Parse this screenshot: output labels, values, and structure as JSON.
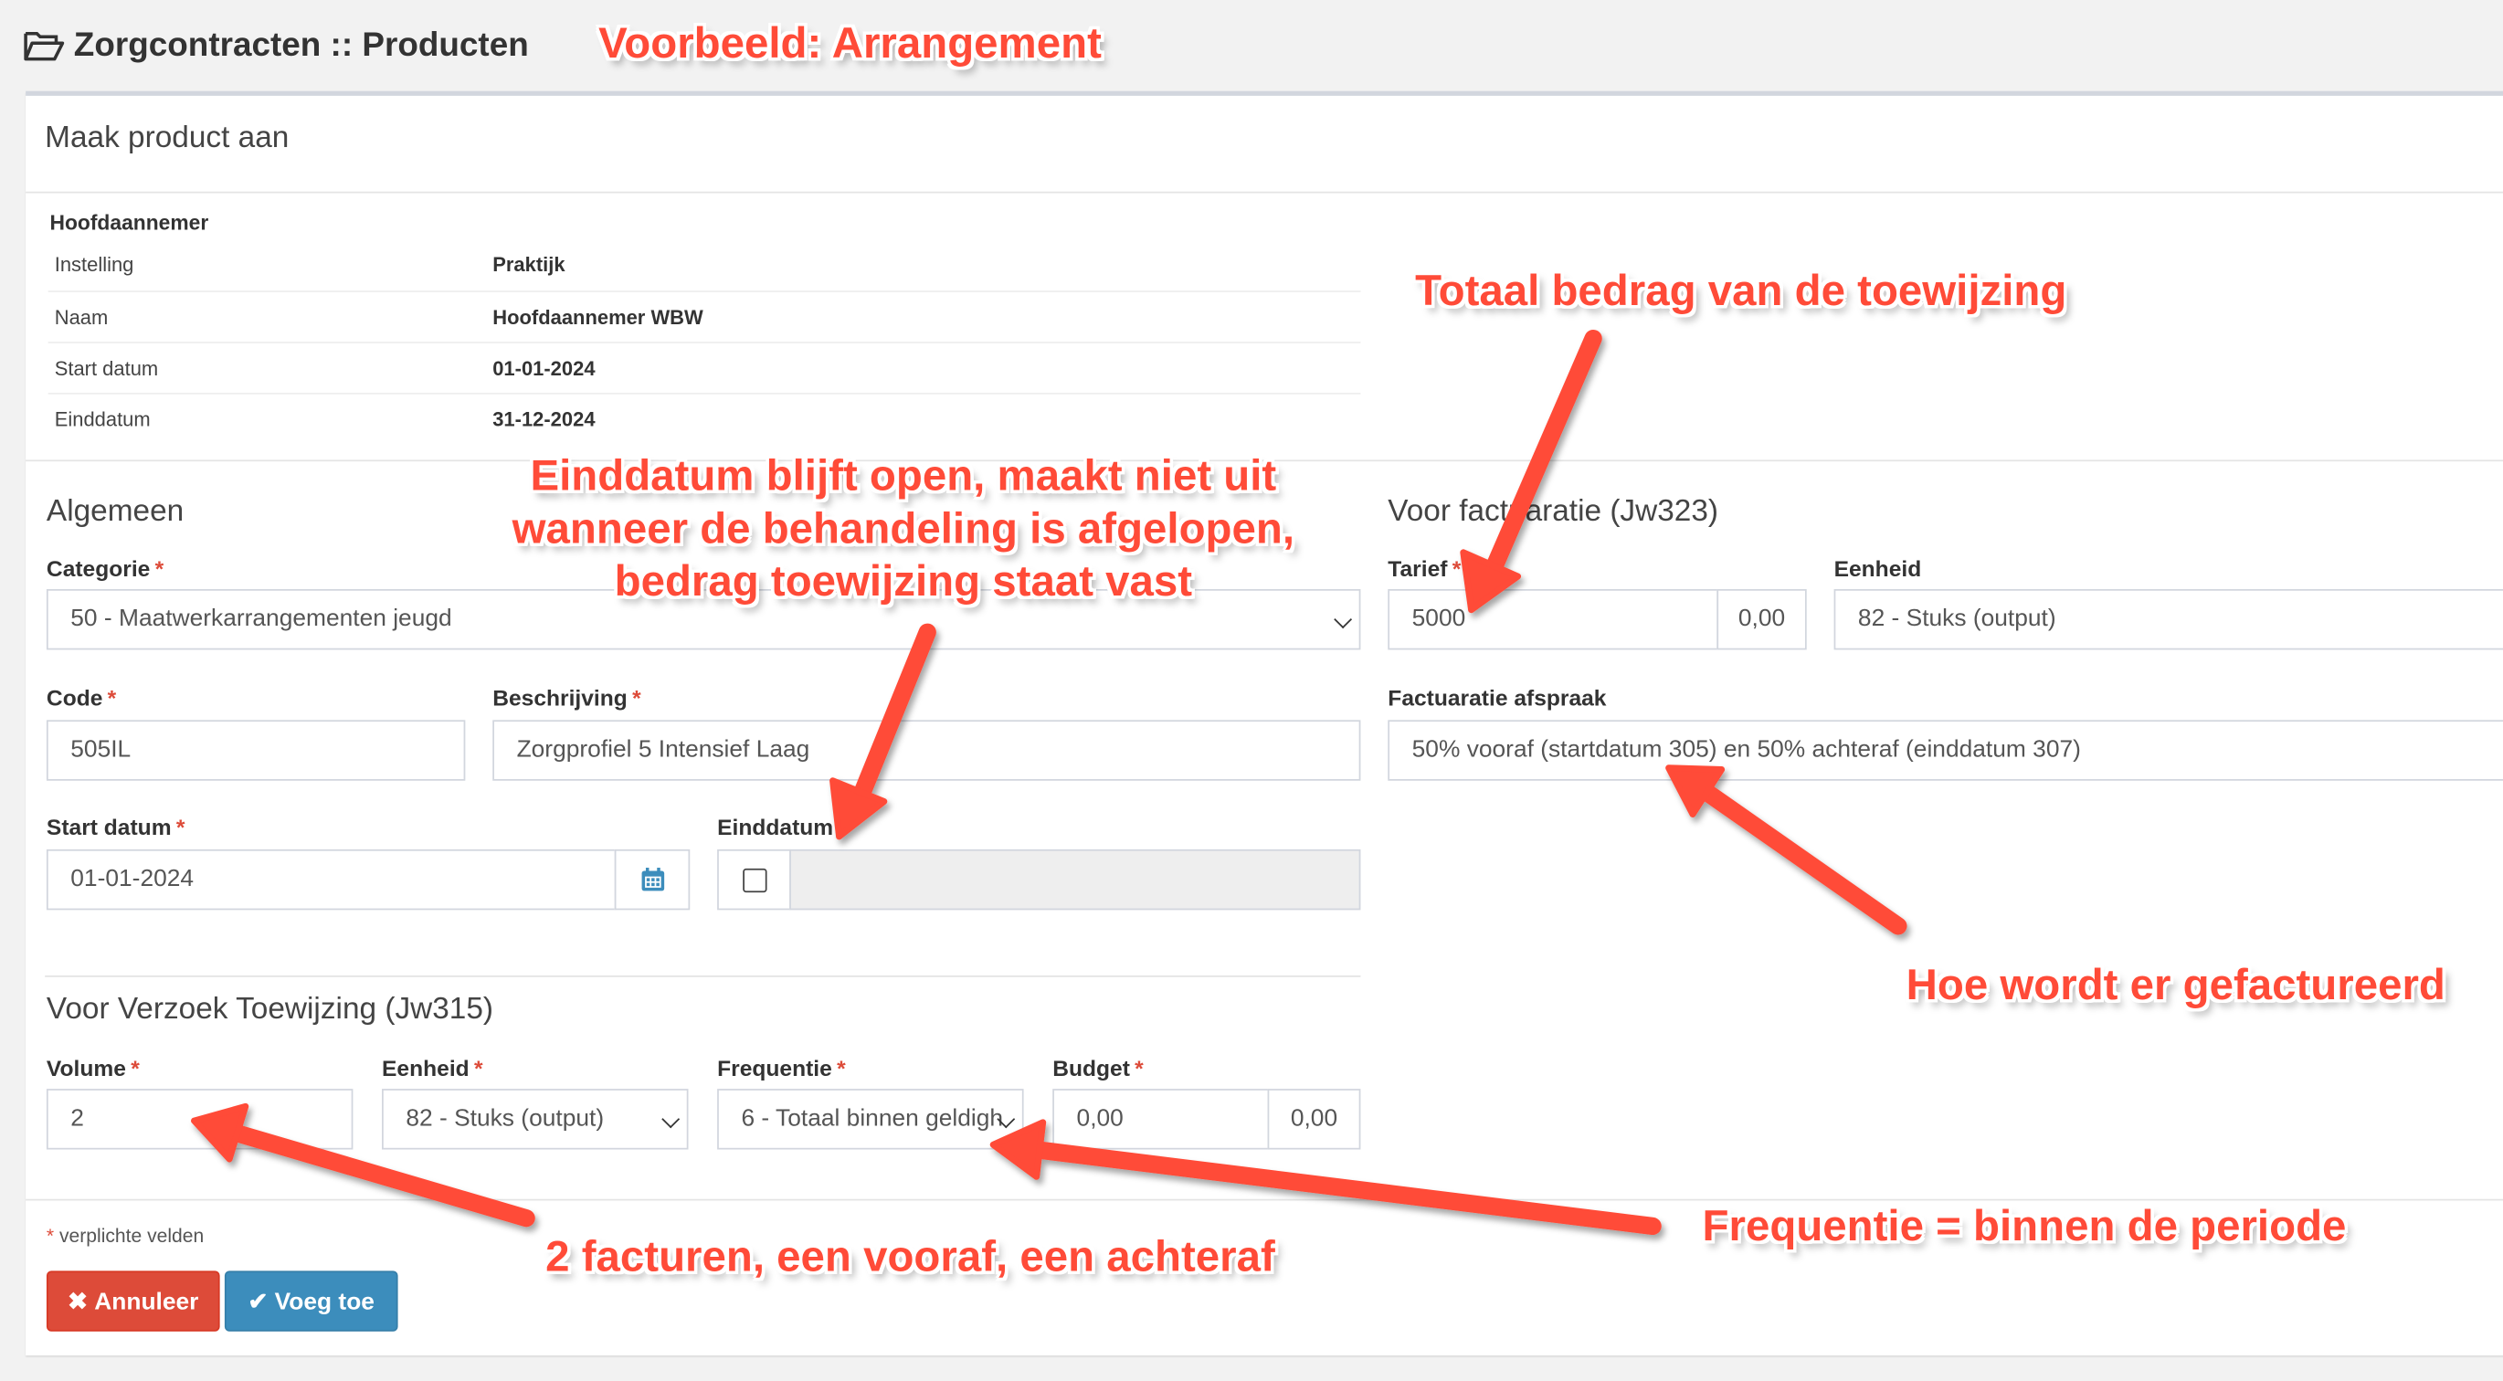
{
  "page": {
    "title": "Zorgcontracten :: Producten",
    "icon": "folder-open-icon"
  },
  "box": {
    "title": "Maak product aan"
  },
  "contractor": {
    "heading": "Hoofdaannemer",
    "rows": [
      {
        "label": "Instelling",
        "value": "Praktijk"
      },
      {
        "label": "Naam",
        "value": "Hoofdaannemer WBW"
      },
      {
        "label": "Start datum",
        "value": "01-01-2024"
      },
      {
        "label": "Einddatum",
        "value": "31-12-2024"
      }
    ]
  },
  "general": {
    "title": "Algemeen",
    "category": {
      "label": "Categorie",
      "value": "50 - Maatwerkarrangementen jeugd"
    },
    "code": {
      "label": "Code",
      "value": "505IL"
    },
    "description": {
      "label": "Beschrijving",
      "value": "Zorgprofiel 5 Intensief Laag"
    },
    "start_date": {
      "label": "Start datum",
      "value": "01-01-2024",
      "icon": "calendar-icon"
    },
    "end_date": {
      "label": "Einddatum",
      "value": "",
      "checked": false
    }
  },
  "billing": {
    "title": "Voor factuaratie (Jw323)",
    "rate": {
      "label": "Tarief",
      "value": "5000",
      "addon": "0,00"
    },
    "unit": {
      "label": "Eenheid",
      "value": "82 - Stuks (output)"
    },
    "agreement": {
      "label": "Factuaratie afspraak",
      "value": "50% vooraf (startdatum 305) en 50% achteraf (einddatum 307)"
    }
  },
  "request": {
    "title": "Voor Verzoek Toewijzing (Jw315)",
    "volume": {
      "label": "Volume",
      "value": "2"
    },
    "unit": {
      "label": "Eenheid",
      "value": "82 - Stuks (output)"
    },
    "frequency": {
      "label": "Frequentie",
      "value": "6 - Totaal binnen geldigh"
    },
    "budget": {
      "label": "Budget",
      "value": "0,00",
      "addon": "0,00"
    }
  },
  "footer": {
    "required_note": "verplichte velden",
    "cancel_label": "Annuleer",
    "add_label": "Voeg toe"
  },
  "annotations": {
    "example": "Voorbeeld: Arrangement",
    "total": "Totaal bedrag van de toewijzing",
    "enddate": [
      "Einddatum blijft open, maakt niet uit",
      "wanneer de behandeling is afgelopen,",
      "bedrag toewijzing staat vast"
    ],
    "invoice_how": "Hoe wordt er gefactureerd",
    "frequency": "Frequentie = binnen de periode",
    "invoices": "2 facturen, een vooraf, een achteraf"
  },
  "colors": {
    "annotation": "#ff4b38",
    "cancel": "#dd4b39",
    "add": "#3c8dbc"
  }
}
